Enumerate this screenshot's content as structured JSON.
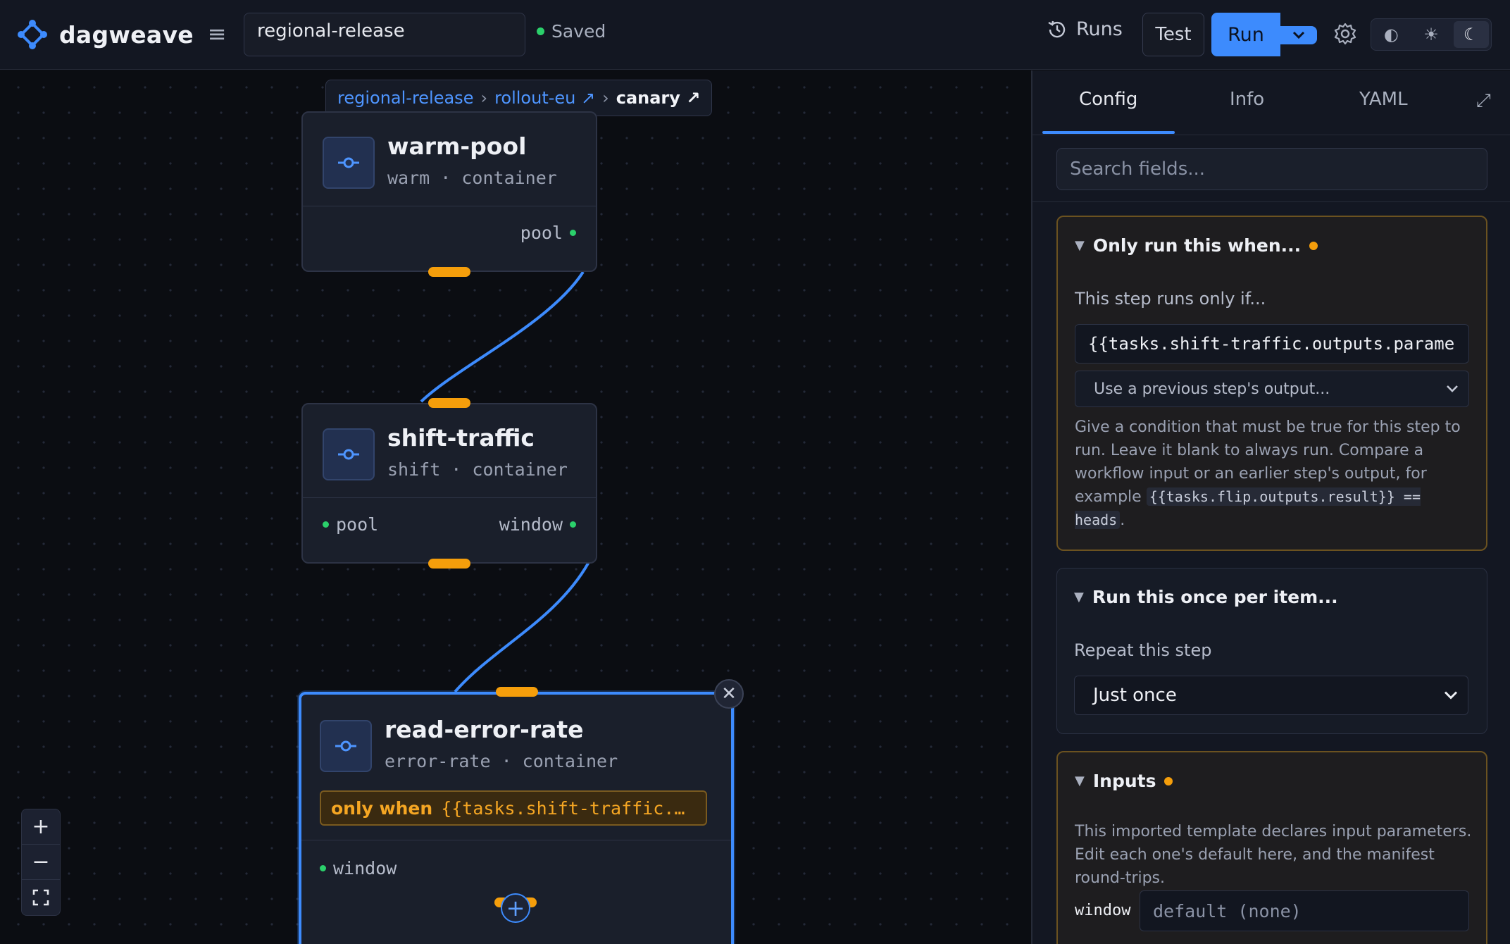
{
  "app": {
    "brand": "dagweave",
    "workflow_name": "regional-release",
    "status": "Saved"
  },
  "toolbar": {
    "runs_label": "Runs",
    "test_label": "Test",
    "run_label": "Run",
    "theme_modes": [
      "◐",
      "☀",
      "☾"
    ]
  },
  "breadcrumb": {
    "items": [
      {
        "label": "regional-release"
      },
      {
        "label": "rollout-eu ↗"
      },
      {
        "label": "canary ↗"
      }
    ],
    "separator": "›"
  },
  "nodes": [
    {
      "title": "warm-pool",
      "subtitle": "warm · container",
      "outputs": [
        "pool"
      ]
    },
    {
      "title": "shift-traffic",
      "subtitle": "shift · container",
      "inputs": [
        "pool"
      ],
      "outputs": [
        "window"
      ]
    },
    {
      "title": "read-error-rate",
      "subtitle": "error-rate · container",
      "condition_keyword": "only when",
      "condition_expr": "{{tasks.shift-traffic.…",
      "inputs": [
        "window"
      ],
      "selected": true
    }
  ],
  "panel": {
    "tabs": [
      {
        "label": "Config",
        "active": true
      },
      {
        "label": "Info"
      },
      {
        "label": "YAML"
      }
    ],
    "search_placeholder": "Search fields...",
    "sections": {
      "condition": {
        "title": "Only run this when...",
        "label": "This step runs only if...",
        "value": "{{tasks.shift-traffic.outputs.parame",
        "picker": "Use a previous step's output...",
        "help_text": "Give a condition that must be true for this step to run. Leave it blank to always run. Compare a workflow input or an earlier step's output, for example ",
        "help_code": "{{tasks.flip.outputs.result}} == heads",
        "help_end": "."
      },
      "loop": {
        "title": "Run this once per item...",
        "label": "Repeat this step",
        "value": "Just once"
      },
      "inputs": {
        "title": "Inputs",
        "help_text": "This imported template declares input parameters. Edit each one's default here, and the manifest round-trips.",
        "param_name": "window",
        "param_placeholder": "default (none)"
      }
    }
  },
  "colors": {
    "accent": "#3d8bfd",
    "warning": "#f59e0b",
    "success": "#2bd06b"
  }
}
